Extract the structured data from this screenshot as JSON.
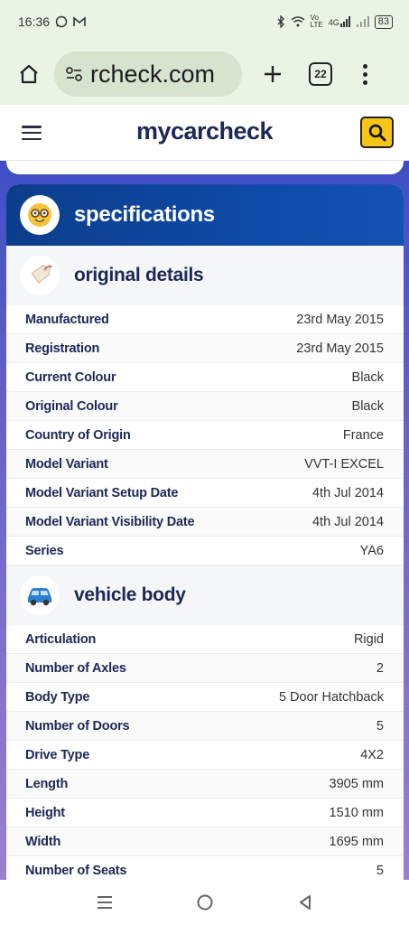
{
  "status_bar": {
    "time": "16:36",
    "battery": "83",
    "volte_top": "Vo",
    "volte_bottom": "LTE",
    "network": "4G"
  },
  "browser": {
    "url": "rcheck.com",
    "tab_count": "22"
  },
  "site": {
    "brand": "mycarcheck"
  },
  "specifications": {
    "title": "specifications",
    "original_details": {
      "title": "original details",
      "rows": [
        {
          "label": "Manufactured",
          "value": "23rd May 2015"
        },
        {
          "label": "Registration",
          "value": "23rd May 2015"
        },
        {
          "label": "Current Colour",
          "value": "Black"
        },
        {
          "label": "Original Colour",
          "value": "Black"
        },
        {
          "label": "Country of Origin",
          "value": "France"
        },
        {
          "label": "Model Variant",
          "value": "VVT-I EXCEL"
        },
        {
          "label": "Model Variant Setup Date",
          "value": "4th Jul 2014"
        },
        {
          "label": "Model Variant Visibility Date",
          "value": "4th Jul 2014"
        },
        {
          "label": "Series",
          "value": "YA6"
        }
      ]
    },
    "vehicle_body": {
      "title": "vehicle body",
      "rows": [
        {
          "label": "Articulation",
          "value": "Rigid"
        },
        {
          "label": "Number of Axles",
          "value": "2"
        },
        {
          "label": "Body Type",
          "value": "5 Door Hatchback"
        },
        {
          "label": "Number of Doors",
          "value": "5"
        },
        {
          "label": "Drive Type",
          "value": "4X2"
        },
        {
          "label": "Length",
          "value": "3905 mm"
        },
        {
          "label": "Height",
          "value": "1510 mm"
        },
        {
          "label": "Width",
          "value": "1695 mm"
        },
        {
          "label": "Number of Seats",
          "value": "5"
        }
      ]
    }
  },
  "icons": {
    "status_left": [
      "whatsapp-icon",
      "gmail-icon"
    ],
    "status_right": [
      "bluetooth-icon",
      "wifi-icon",
      "signal-icon",
      "battery-icon"
    ],
    "spec_header": "nerd-face-emoji-icon",
    "original_details": "price-tag-emoji-icon",
    "vehicle_body": "car-emoji-icon"
  },
  "colors": {
    "brand_navy": "#1d2855",
    "spec_header_blue": "#0e4aa6",
    "search_yellow": "#f5c518",
    "status_bar_bg": "#eaf4e4"
  }
}
